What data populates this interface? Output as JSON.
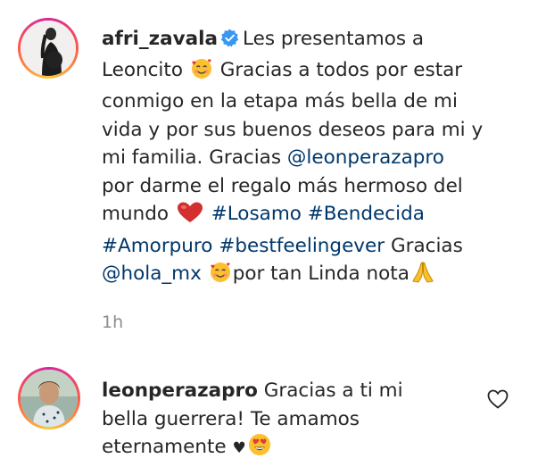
{
  "post": {
    "username": "afri_zavala",
    "verified_icon": "verified-badge-icon",
    "line1": "Les presentamos a",
    "line2_a": "Leoncito",
    "emoji_smiling_hearts": "smiling-face-with-hearts-icon",
    "line2_b": "Gracias a todos por estar",
    "line3": "conmigo en la etapa más bella de mi",
    "line4": "vida y por sus buenos deseos para mi y",
    "line5_a": "mi familia. Gracias",
    "mention1": "@leonperazapro",
    "line6": "por darme el regalo más hermoso del",
    "line7_a": "mundo",
    "emoji_heart": "red-heart-icon",
    "hashtag1": "#Losamo",
    "hashtag2": "#Bendecida",
    "hashtag3": "#Amorpuro",
    "hashtag4": "#bestfeelingever",
    "line8_b": "Gracias",
    "mention2": "@hola_mx",
    "line9_b": "por tan Linda nota",
    "emoji_pray": "folded-hands-icon",
    "timestamp": "1h"
  },
  "reply": {
    "username": "leonperazapro",
    "line1": "Gracias a ti mi",
    "line2": "bella guerrera! Te amamos",
    "line3": "eternamente",
    "black_heart": "♥",
    "emoji_heart_eyes": "heart-eyes-icon",
    "like_icon": "heart-outline-icon"
  },
  "colors": {
    "text": "#262626",
    "link": "#00376b",
    "muted": "#8e8e8e",
    "verified": "#3897f0"
  }
}
